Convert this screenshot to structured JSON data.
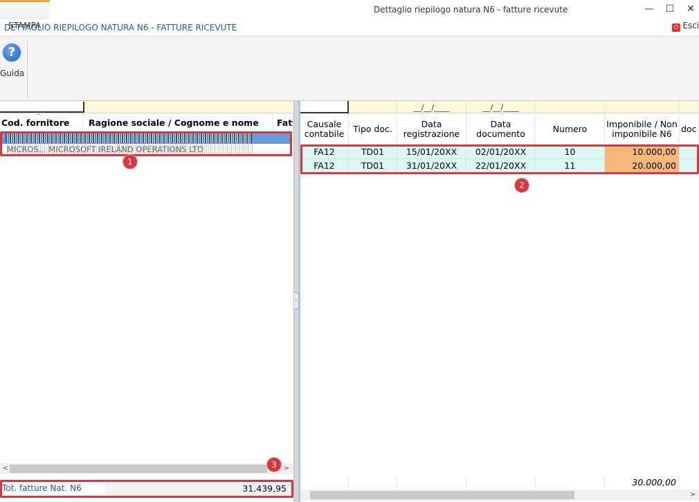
{
  "window": {
    "title": "Dettaglio riepilogo natura N6 - fatture ricevute",
    "minimize": "—",
    "maximize": "☐",
    "close": "✕"
  },
  "tabs": [
    {
      "label": "DETTAGLIO RIEPILOGO NATURA N6 - FATTURE RICEVUTE",
      "active": true
    },
    {
      "label": "STAMPA",
      "active": false
    }
  ],
  "esci": {
    "label": "Esci",
    "icon": "power-icon"
  },
  "ribbon": {
    "guida_label": "Guida",
    "guida_icon": "help-icon",
    "guida_glyph": "?"
  },
  "left": {
    "columns": [
      "Cod. fornitore",
      "Ragione sociale / Cognome e nome",
      "Fatt"
    ],
    "rows": [
      {
        "text": "",
        "redacted": true,
        "selected": true
      },
      {
        "text": "MICROS... MICROSOFT IRELAND OPERATIONS LTD",
        "redacted": true,
        "selected": false
      }
    ],
    "total_label": "Tot. fatture Nat. N6",
    "total_value": "31.439,95",
    "scroll_left": "<",
    "scroll_right": ">"
  },
  "right": {
    "filters": [
      "",
      "",
      "__/__/____",
      "__/__/____",
      "",
      "",
      ""
    ],
    "columns": [
      "Causale contabile",
      "Tipo doc.",
      "Data registrazione",
      "Data documento",
      "Numero",
      "Imponibile / Non imponibile N6",
      "doc"
    ],
    "rows": [
      {
        "causale": "FA12",
        "tipo": "TD01",
        "data_reg": "15/01/20XX",
        "data_doc": "02/01/20XX",
        "numero": "10",
        "imponibile": "10.000,00"
      },
      {
        "causale": "FA12",
        "tipo": "TD01",
        "data_reg": "31/01/20XX",
        "data_doc": "22/01/20XX",
        "numero": "11",
        "imponibile": "20.000,00"
      }
    ],
    "footer_total": "30.000,00",
    "scroll_right": ">"
  },
  "badges": [
    "1",
    "2",
    "3"
  ],
  "colors": {
    "accent_blue": "#2b579a",
    "annotation_red": "#d9363e",
    "row_selected": "#6b9bd6",
    "row_cyan": "#dcf6f4",
    "cell_orange": "#f6b77a",
    "filter_yellow": "#fdf6d9"
  }
}
